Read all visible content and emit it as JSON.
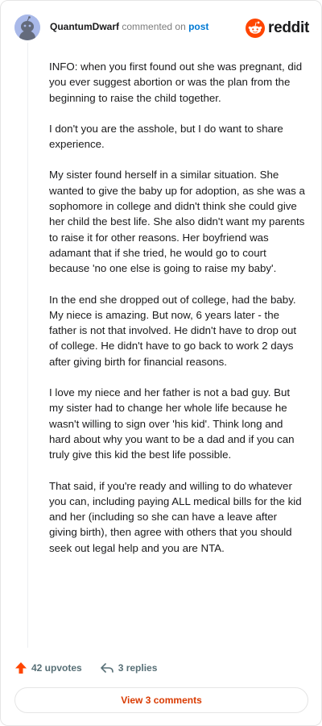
{
  "header": {
    "username": "QuantumDwarf",
    "action_text": "commented on",
    "post_link": "post",
    "brand": "reddit"
  },
  "comment": {
    "paragraphs": [
      "INFO: when you first found out she was pregnant, did you ever suggest abortion or was the plan from the beginning to raise the child together.",
      "I don't you are the asshole, but I do want to share experience.",
      "My sister found herself in a similar situation. She wanted to give the baby up for adoption, as she was a sophomore in college and didn't think she could give her child the best life. She also didn't want my parents to raise it for other reasons. Her boyfriend was adamant that if she tried, he would go to court because 'no one else is going to raise my baby'.",
      "In the end she dropped out of college, had the baby. My niece is amazing. But now, 6 years later - the father is not that involved. He didn't have to drop out of college. He didn't have to go back to work 2 days after giving birth for financial reasons.",
      "I love my niece and her father is not a bad guy. But my sister had to change her whole life because he wasn't willing to sign over 'his kid'. Think long and hard about why you want to be a dad and if you can truly give this kid the best life possible.",
      "That said, if you're ready and willing to do whatever you can, including paying ALL medical bills for the kid and her (including so she can have a leave after giving birth), then agree with others that you should seek out legal help and you are NTA."
    ]
  },
  "footer": {
    "upvotes": "42 upvotes",
    "replies": "3 replies",
    "view_comments": "View 3 comments"
  },
  "icons": {
    "upvote": "upvote-arrow-icon",
    "reply": "reply-arrow-icon",
    "logo": "reddit-snoo-icon"
  },
  "colors": {
    "upvote": "#ff4500",
    "link": "#0079d3",
    "view_comments": "#d93a00",
    "muted": "#576f76"
  }
}
